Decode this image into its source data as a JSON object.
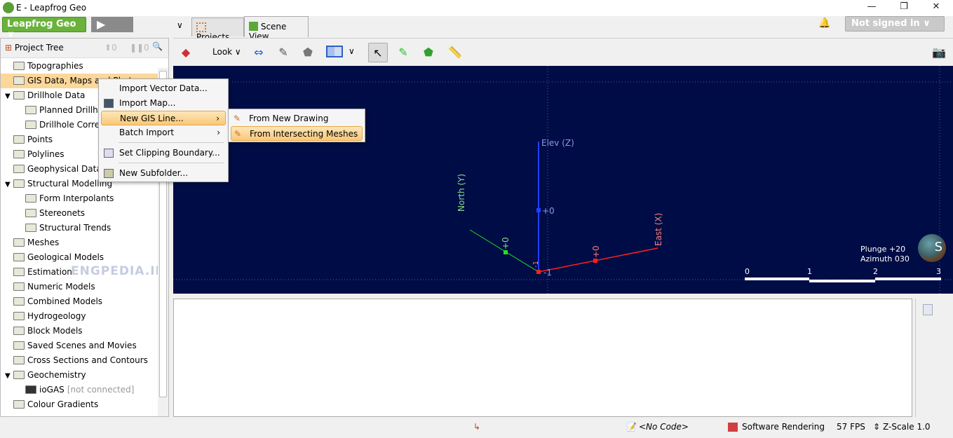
{
  "window": {
    "title": "E - Leapfrog Geo",
    "minimize": "—",
    "restore": "❐",
    "close": "✕"
  },
  "topbar": {
    "app_button": "Leapfrog Geo ∨",
    "play": "▶",
    "tab_dropdown": "∨",
    "tabs": [
      {
        "label": "Projects",
        "active": false
      },
      {
        "label": "Scene View",
        "active": true
      }
    ],
    "bell": "🔔",
    "signin": "Not signed in ∨"
  },
  "tree": {
    "header": "Project Tree",
    "up_count": "0",
    "pause_count": "0",
    "items": [
      {
        "label": "Topographies",
        "level": 0,
        "expanded": null
      },
      {
        "label": "GIS Data, Maps and Photos",
        "level": 0,
        "expanded": null,
        "selected": true
      },
      {
        "label": "Drillhole Data",
        "level": 0,
        "expanded": true
      },
      {
        "label": "Planned Drillholes",
        "level": 1
      },
      {
        "label": "Drillhole Correlation",
        "level": 1
      },
      {
        "label": "Points",
        "level": 0
      },
      {
        "label": "Polylines",
        "level": 0
      },
      {
        "label": "Geophysical Data",
        "level": 0
      },
      {
        "label": "Structural Modelling",
        "level": 0,
        "expanded": true
      },
      {
        "label": "Form Interpolants",
        "level": 1
      },
      {
        "label": "Stereonets",
        "level": 1
      },
      {
        "label": "Structural Trends",
        "level": 1
      },
      {
        "label": "Meshes",
        "level": 0
      },
      {
        "label": "Geological Models",
        "level": 0
      },
      {
        "label": "Estimation",
        "level": 0
      },
      {
        "label": "Numeric Models",
        "level": 0
      },
      {
        "label": "Combined Models",
        "level": 0
      },
      {
        "label": "Hydrogeology",
        "level": 0
      },
      {
        "label": "Block Models",
        "level": 0
      },
      {
        "label": "Saved Scenes and Movies",
        "level": 0
      },
      {
        "label": "Cross Sections and Contours",
        "level": 0
      },
      {
        "label": "Geochemistry",
        "level": 0,
        "expanded": true
      },
      {
        "label": "ioGAS",
        "level": 1,
        "suffix": "[not connected]",
        "icon": "computer"
      },
      {
        "label": "Colour Gradients",
        "level": 0
      }
    ]
  },
  "watermark": "ENGPEDIA.IR",
  "toolbar": {
    "look": "Look ∨"
  },
  "context_menu": {
    "items": [
      {
        "label": "Import Vector Data..."
      },
      {
        "label": "Import Map...",
        "icon": "map"
      },
      {
        "label": "New GIS Line...",
        "submenu": true,
        "highlighted": true
      },
      {
        "label": "Batch Import",
        "submenu": true
      },
      {
        "label": "Set Clipping Boundary...",
        "icon": "clip"
      },
      {
        "label": "New Subfolder...",
        "icon": "folder"
      }
    ],
    "submenu": [
      {
        "label": "From New Drawing"
      },
      {
        "label": "From Intersecting Meshes",
        "highlighted": true
      }
    ]
  },
  "scene": {
    "axes": {
      "z_label": "Elev (Z)",
      "y_label": "North (Y)",
      "x_label": "East (X)",
      "z_tick": "+0",
      "y_tick": "+0",
      "x_tick": "+0",
      "origin_tick": "-1",
      "origin_tick2": "-1"
    },
    "orientation": {
      "plunge": "Plunge +20",
      "azimuth": "Azimuth 030",
      "compass": "S"
    },
    "scale_bar": [
      "0",
      "1",
      "2",
      "3"
    ],
    "colors": {
      "background": "#000c45",
      "x_axis": "#ff2020",
      "y_axis": "#22e022",
      "z_axis": "#2040ff"
    }
  },
  "status": {
    "no_code": "<No Code>",
    "rendering": "Software Rendering",
    "fps": "57 FPS",
    "zscale": "Z-Scale 1.0"
  }
}
